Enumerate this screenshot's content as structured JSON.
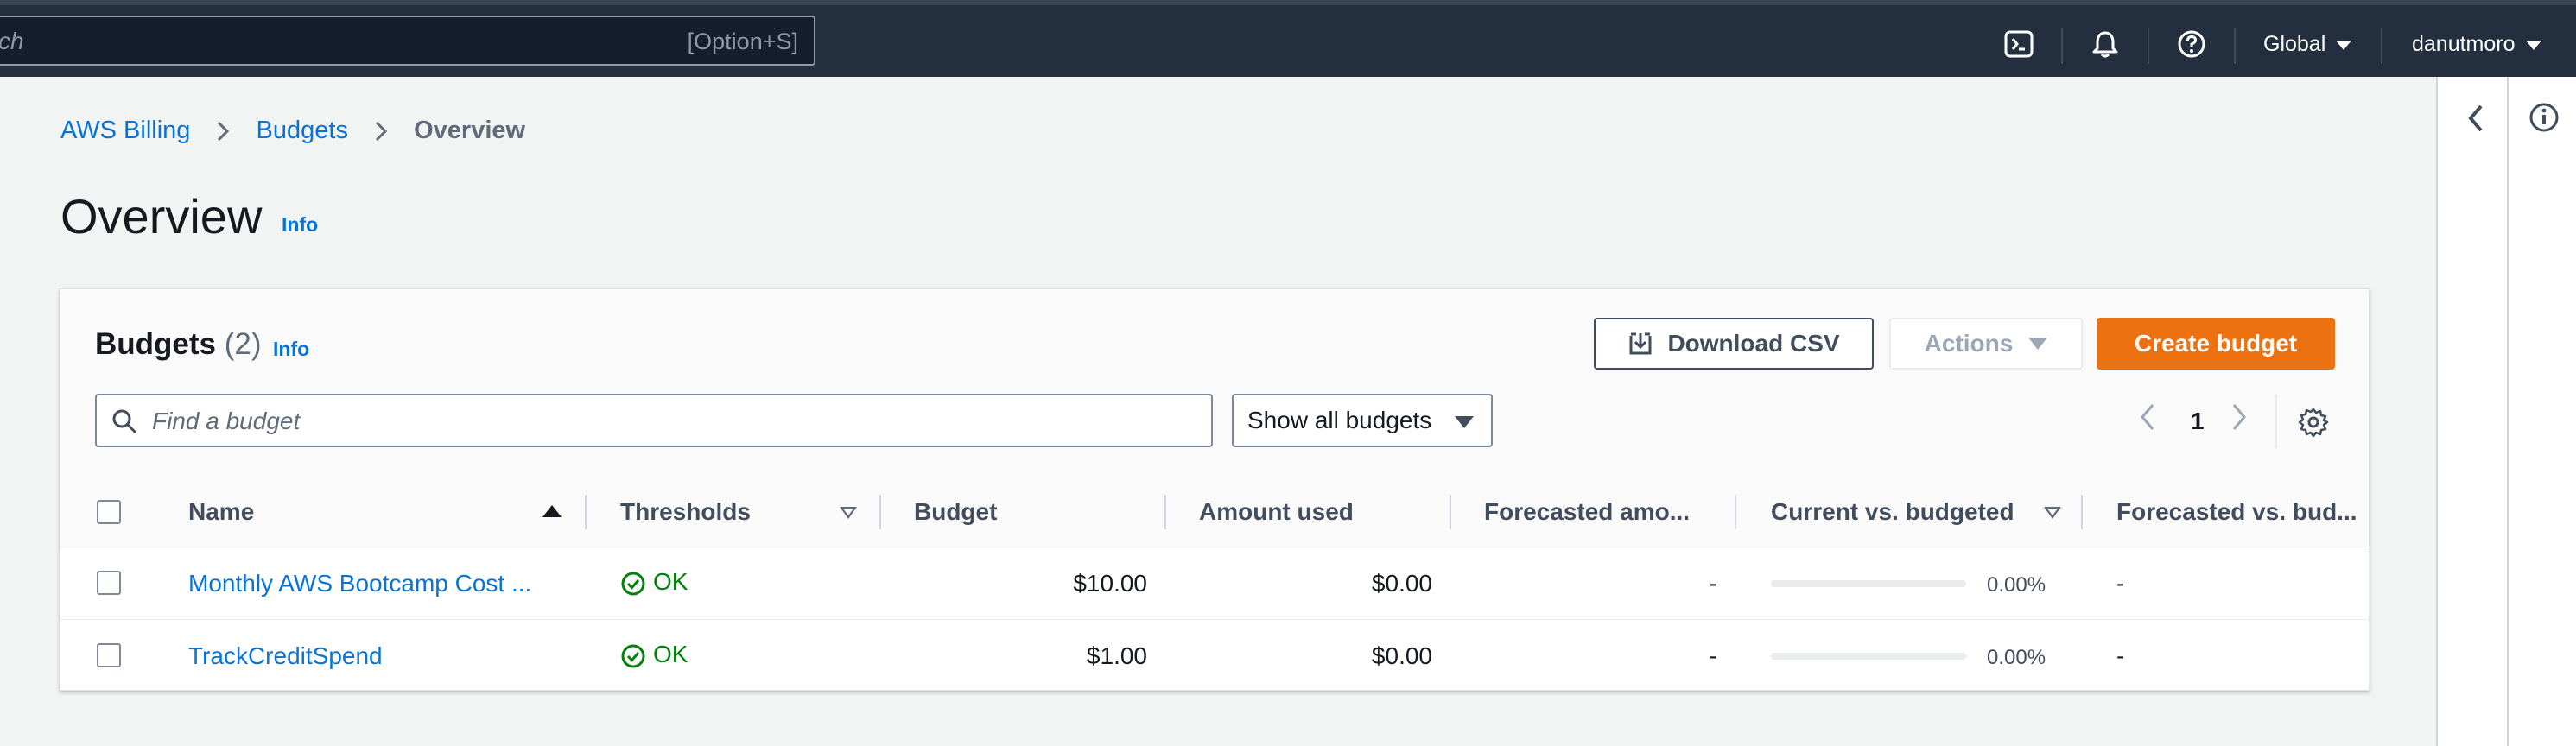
{
  "topbar": {
    "search_partial": "ch",
    "search_shortcut": "[Option+S]",
    "region": "Global",
    "user": "danutmoro"
  },
  "breadcrumb": {
    "items": [
      "AWS Billing",
      "Budgets"
    ],
    "current": "Overview"
  },
  "page": {
    "title": "Overview",
    "info": "Info"
  },
  "budgets": {
    "title": "Budgets",
    "count": "(2)",
    "info": "Info",
    "download_label": "Download CSV",
    "actions_label": "Actions",
    "create_label": "Create budget",
    "search_placeholder": "Find a budget",
    "filter_label": "Show all budgets",
    "page": "1"
  },
  "table": {
    "columns": [
      "Name",
      "Thresholds",
      "Budget",
      "Amount used",
      "Forecasted amo...",
      "Current vs. budgeted",
      "Forecasted vs. bud..."
    ],
    "rows": [
      {
        "name": "Monthly AWS Bootcamp Cost ...",
        "threshold": "OK",
        "budget": "$10.00",
        "used": "$0.00",
        "forecast": "-",
        "current_pct_label": "0.00%",
        "current_pct": 0,
        "forecast_vs": "-"
      },
      {
        "name": "TrackCreditSpend",
        "threshold": "OK",
        "budget": "$1.00",
        "used": "$0.00",
        "forecast": "-",
        "current_pct_label": "0.00%",
        "current_pct": 0,
        "forecast_vs": "-"
      }
    ]
  },
  "colors": {
    "topbar": "#232f3e",
    "link": "#0972d3",
    "primary": "#ec7211",
    "ok": "#037f0c"
  }
}
